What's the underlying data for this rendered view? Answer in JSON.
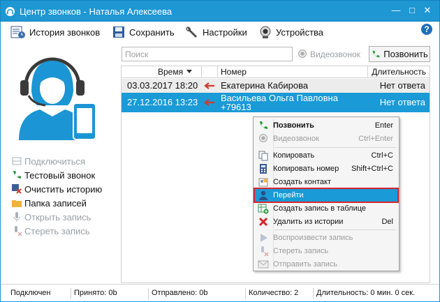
{
  "window": {
    "title": "Центр звонков - Наталья Алексеева",
    "minimize_glyph": "—",
    "maximize_glyph": "□",
    "close_glyph": "✕"
  },
  "toolbar": {
    "history_label": "История звонков",
    "save_label": "Сохранить",
    "settings_label": "Настройки",
    "devices_label": "Устройства",
    "help_glyph": "?"
  },
  "sidebar": {
    "items": [
      {
        "label": "Подключиться",
        "icon": "connect-icon",
        "enabled": false
      },
      {
        "label": "Тестовый звонок",
        "icon": "phone-icon",
        "enabled": true
      },
      {
        "label": "Очистить историю",
        "icon": "clear-history-icon",
        "enabled": true
      },
      {
        "label": "Папка записей",
        "icon": "folder-icon",
        "enabled": true
      },
      {
        "label": "Открыть запись",
        "icon": "microphone-icon",
        "enabled": false
      },
      {
        "label": "Стереть запись",
        "icon": "microphone-delete-icon",
        "enabled": false
      }
    ]
  },
  "search": {
    "placeholder": "Поиск"
  },
  "actions": {
    "videocall_label": "Видеозвонок",
    "call_label": "Позвонить"
  },
  "table": {
    "columns": [
      "Время",
      "Номер",
      "Длительность"
    ],
    "rows": [
      {
        "time": "03.03.2017 18:20",
        "direction": "outgoing-arrow-icon",
        "number": "Екатерина Кабирова",
        "number_line2": "",
        "duration": "Нет ответа",
        "selected": false
      },
      {
        "time": "27.12.2016 13:23",
        "direction": "outgoing-arrow-icon",
        "number": "Васильева Ольга Павловна",
        "number_line2": "+79613",
        "duration": "Нет ответа",
        "selected": true
      }
    ]
  },
  "context_menu": {
    "items": [
      {
        "label": "Позвонить",
        "shortcut": "Enter",
        "icon": "phone-icon",
        "bold": true,
        "enabled": true
      },
      {
        "label": "Видеозвонок",
        "shortcut": "Ctrl+Enter",
        "icon": "webcam-icon",
        "bold": false,
        "enabled": false
      },
      {
        "label": "Копировать",
        "shortcut": "Ctrl+C",
        "icon": "copy-icon",
        "bold": false,
        "enabled": true
      },
      {
        "label": "Копировать номер",
        "shortcut": "Shift+Ctrl+C",
        "icon": "calculator-icon",
        "bold": false,
        "enabled": true
      },
      {
        "label": "Создать контакт",
        "shortcut": "",
        "icon": "create-contact-icon",
        "bold": false,
        "enabled": true
      },
      {
        "label": "Перейти",
        "shortcut": "",
        "icon": "user-icon",
        "bold": false,
        "enabled": true,
        "highlighted": true
      },
      {
        "label": "Создать запись в таблице",
        "shortcut": "",
        "icon": "table-add-icon",
        "bold": false,
        "enabled": true
      },
      {
        "label": "Удалить из истории",
        "shortcut": "Del",
        "icon": "delete-icon",
        "bold": false,
        "enabled": true
      },
      {
        "label": "Воспроизвести запись",
        "shortcut": "",
        "icon": "play-icon",
        "bold": false,
        "enabled": false
      },
      {
        "label": "Стереть запись",
        "shortcut": "",
        "icon": "microphone-delete-icon",
        "bold": false,
        "enabled": false
      },
      {
        "label": "Отправить запись",
        "shortcut": "",
        "icon": "mail-icon",
        "bold": false,
        "enabled": false
      }
    ]
  },
  "statusbar": {
    "connection": "Подключен",
    "received": "Принято: 0b",
    "sent": "Отправлено: 0b",
    "count": "Количество: 2",
    "duration": "Длительность: 0 мин. 0 сек."
  },
  "colors": {
    "accent": "#1e97d3",
    "selection": "#1a9ad6",
    "highlight_border": "#d7262e",
    "arrow": "#d23a2a"
  }
}
